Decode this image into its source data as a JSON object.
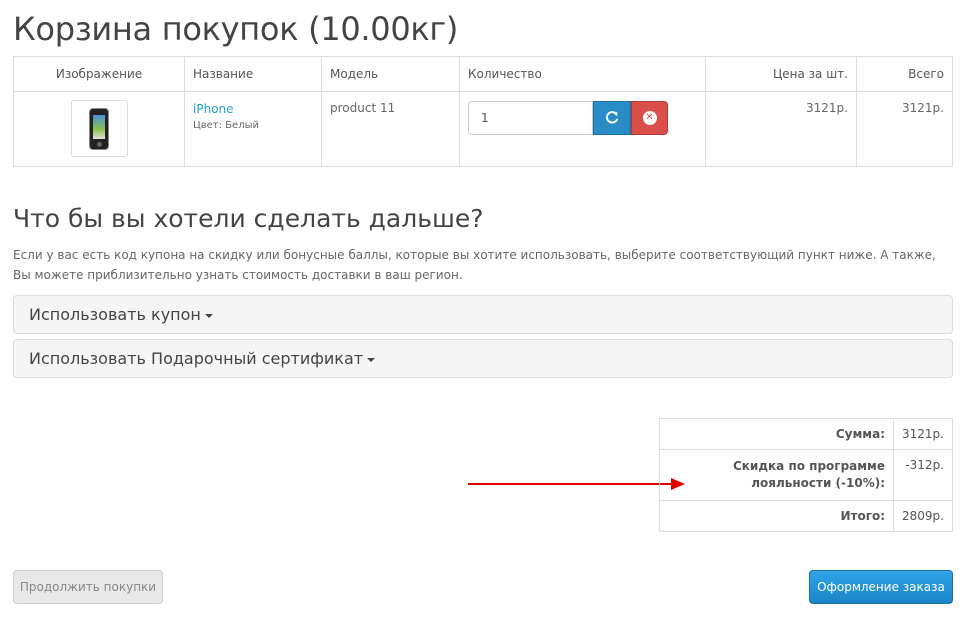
{
  "page": {
    "title": "Корзина покупок  (10.00кг)"
  },
  "cart": {
    "columns": [
      "Изображение",
      "Название",
      "Модель",
      "Количество",
      "Цена за шт.",
      "Всего"
    ],
    "items": [
      {
        "image_icon": "iphone-thumbnail",
        "name": "iPhone",
        "option": "Цвет: Белый",
        "model": "product 11",
        "quantity": "1",
        "unit_price": "3121р.",
        "total": "3121р."
      }
    ]
  },
  "next": {
    "title": "Что бы вы хотели сделать дальше?",
    "intro": "Если у вас есть код купона на скидку или бонусные баллы, которые вы хотите использовать, выберите соответствующий пункт ниже. А также, Вы можете приблизительно узнать стоимость доставки в ваш регион.",
    "panels": [
      {
        "label": "Использовать купон"
      },
      {
        "label": "Использовать Подарочный сертификат"
      }
    ]
  },
  "totals": [
    {
      "label": "Сумма:",
      "value": "3121р."
    },
    {
      "label": "Скидка по программе лояльности (-10%):",
      "value": "-312р."
    },
    {
      "label": "Итого:",
      "value": "2809р."
    }
  ],
  "actions": {
    "continue_label": "Продолжить покупки",
    "checkout_label": "Оформление заказа"
  },
  "colors": {
    "link": "#23a1d1",
    "refresh": "#2a8cc7",
    "remove": "#da4f49",
    "checkout": "#1b86c5",
    "annotation_arrow": "#e00000"
  },
  "icons": {
    "refresh": "refresh-icon",
    "remove": "remove-circle-icon",
    "caret": "caret-down-icon",
    "arrow": "red-arrow-annotation"
  }
}
